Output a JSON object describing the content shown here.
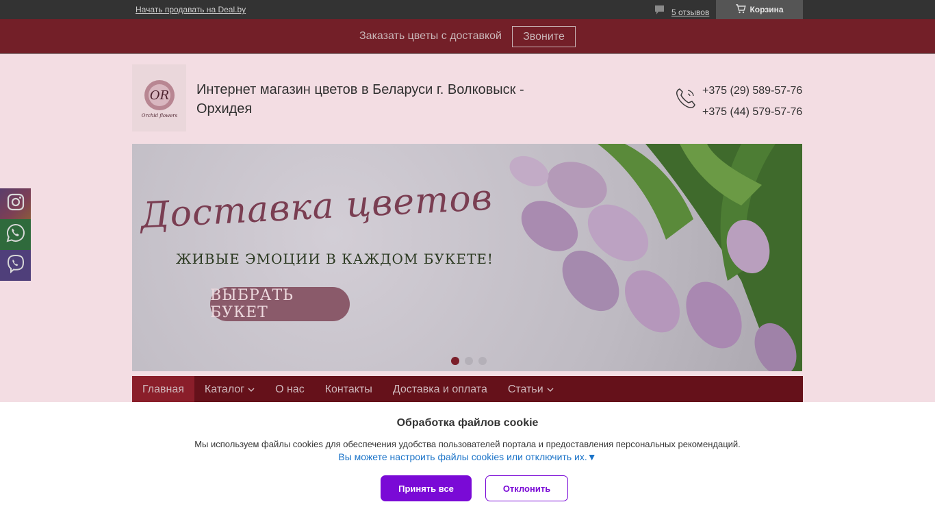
{
  "topbar": {
    "sell_link": "Начать продавать на Deal.by",
    "reviews_label": "5 отзывов",
    "cart_label": "Корзина"
  },
  "promo": {
    "text": "Заказать цветы с доставкой",
    "call_button": "Звоните"
  },
  "header": {
    "title": "Интернет магазин цветов в Беларуси г. Волковыск - Орхидея",
    "logo_text": "Orchid flowers",
    "phones": [
      "+375 (29) 589-57-76",
      "+375 (44) 579-57-76"
    ]
  },
  "social": {
    "items": [
      "instagram-icon",
      "whatsapp-icon",
      "viber-icon"
    ]
  },
  "banner": {
    "script_title": "Доставка цветов",
    "subtitle": "ЖИВЫЕ ЭМОЦИИ В КАЖДОМ БУКЕТЕ!",
    "button": "ВЫБРАТЬ БУКЕТ",
    "slides_count": 3,
    "active_slide": 1
  },
  "nav": {
    "items": [
      {
        "label": "Главная",
        "active": true,
        "dropdown": false
      },
      {
        "label": "Каталог",
        "active": false,
        "dropdown": true
      },
      {
        "label": "О нас",
        "active": false,
        "dropdown": false
      },
      {
        "label": "Контакты",
        "active": false,
        "dropdown": false
      },
      {
        "label": "Доставка и оплата",
        "active": false,
        "dropdown": false
      },
      {
        "label": "Статьи",
        "active": false,
        "dropdown": true
      }
    ]
  },
  "cookie": {
    "title": "Обработка файлов cookie",
    "text": "Мы используем файлы cookies для обеспечения удобства пользователей портала и предоставления персональных рекомендаций.",
    "settings_link": "Вы можете настроить файлы cookies или отключить их.▼",
    "accept": "Принять все",
    "decline": "Отклонить"
  },
  "colors": {
    "topbar": "#333333",
    "promo": "#731f28",
    "nav": "#65111a",
    "nav_active": "#8a1e2a",
    "accept_button": "#7a0ad6",
    "link": "#1a73c8"
  }
}
